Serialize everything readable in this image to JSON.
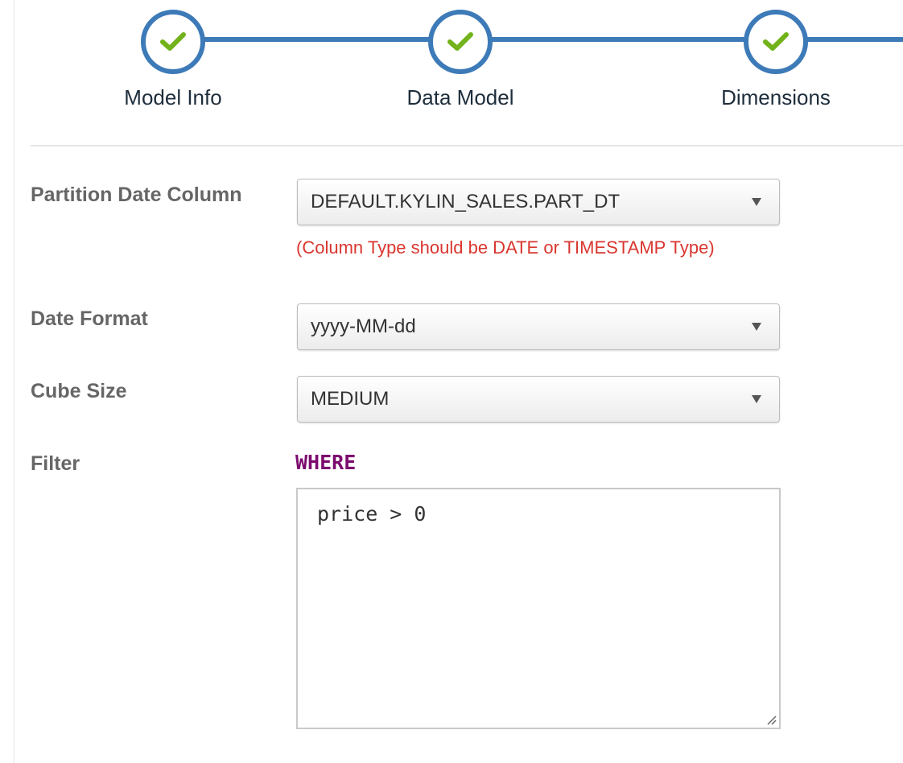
{
  "wizard": {
    "steps": [
      {
        "label": "Model Info",
        "status": "complete",
        "icon": "check-icon"
      },
      {
        "label": "Data Model",
        "status": "complete",
        "icon": "check-icon"
      },
      {
        "label": "Dimensions",
        "status": "complete",
        "icon": "check-icon"
      }
    ],
    "colors": {
      "line": "#3d7ab8",
      "check": "#72b21a"
    }
  },
  "form": {
    "partition_date_column": {
      "label": "Partition Date Column",
      "value": "DEFAULT.KYLIN_SALES.PART_DT",
      "hint": "(Column Type should be DATE or TIMESTAMP Type)"
    },
    "date_format": {
      "label": "Date Format",
      "value": "yyyy-MM-dd"
    },
    "cube_size": {
      "label": "Cube Size",
      "value": "MEDIUM"
    },
    "filter": {
      "label": "Filter",
      "keyword": "WHERE",
      "value": "price > 0"
    }
  },
  "colors": {
    "label": "#666666",
    "hint": "#d9362f",
    "keyword": "#7c0a6e"
  }
}
